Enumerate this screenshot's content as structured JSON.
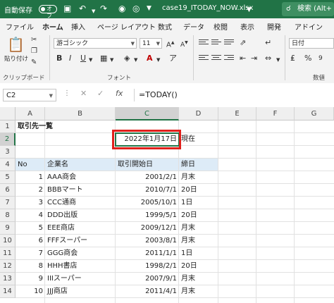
{
  "titlebar": {
    "autosave_label": "自動保存",
    "autosave_state": "オフ",
    "filename": "case19_ITODAY_NOW.xlsx",
    "search_label": "検索 (Alt+"
  },
  "tabs": [
    "ファイル",
    "ホーム",
    "挿入",
    "ページ レイアウト",
    "数式",
    "データ",
    "校閲",
    "表示",
    "開発",
    "アドイン"
  ],
  "active_tab": "ホーム",
  "ribbon": {
    "paste_label": "貼り付け",
    "clipboard_group": "クリップボード",
    "font_name": "游ゴシック",
    "font_size": "11",
    "font_group": "フォント",
    "number_format": "日付",
    "number_group": "数値"
  },
  "formula_bar": {
    "name_box": "C2",
    "fx_label": "fx",
    "formula": "=TODAY()"
  },
  "columns": [
    "A",
    "B",
    "C",
    "D",
    "E",
    "F",
    "G"
  ],
  "rows": [
    "1",
    "2",
    "3",
    "4",
    "5",
    "6",
    "7",
    "8",
    "9",
    "10",
    "11",
    "12",
    "13",
    "14"
  ],
  "sheet": {
    "title": "取引先一覧",
    "today_value": "2022年1月17日",
    "today_suffix": "現在",
    "headers": [
      "No",
      "企業名",
      "取引開始日",
      "締日"
    ],
    "records": [
      {
        "no": "1",
        "name": "AAA商会",
        "date": "2001/2/1",
        "close": "月末"
      },
      {
        "no": "2",
        "name": "BBBマート",
        "date": "2010/7/1",
        "close": "20日"
      },
      {
        "no": "3",
        "name": "CCC通商",
        "date": "2005/10/1",
        "close": "1日"
      },
      {
        "no": "4",
        "name": "DDD出版",
        "date": "1999/5/1",
        "close": "20日"
      },
      {
        "no": "5",
        "name": "EEE商店",
        "date": "2009/12/1",
        "close": "月末"
      },
      {
        "no": "6",
        "name": "FFFスーパー",
        "date": "2003/8/1",
        "close": "月末"
      },
      {
        "no": "7",
        "name": "GGG商会",
        "date": "2011/1/1",
        "close": "1日"
      },
      {
        "no": "8",
        "name": "HHH書店",
        "date": "1998/2/1",
        "close": "20日"
      },
      {
        "no": "9",
        "name": "IIIスーパー",
        "date": "2007/9/1",
        "close": "月末"
      },
      {
        "no": "10",
        "name": "JJJ商店",
        "date": "2011/4/1",
        "close": "月末"
      }
    ]
  }
}
